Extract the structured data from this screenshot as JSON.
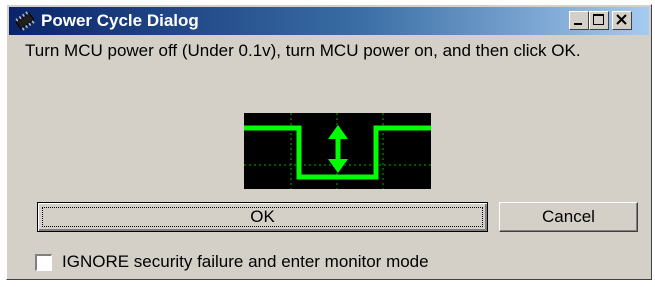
{
  "window": {
    "title": "Power Cycle Dialog",
    "title_icon": "chip-icon",
    "controls": {
      "minimize_icon": "minimize-icon",
      "maximize_icon": "maximize-icon",
      "close_icon": "close-icon"
    }
  },
  "message": {
    "text": "Turn MCU power off (Under 0.1v), turn MCU power on, and then click OK."
  },
  "graphic": {
    "icon": "power-cycle-waveform-icon",
    "colors": {
      "background": "#000000",
      "waveform": "#00ff00",
      "grid": "#00aa00"
    }
  },
  "buttons": {
    "ok_label": "OK",
    "cancel_label": "Cancel"
  },
  "options": {
    "ignore_security_label": "IGNORE security failure and enter monitor mode",
    "ignore_security_checked": false
  },
  "colors": {
    "face": "#d4d0c8",
    "title_start": "#0a246a",
    "title_end": "#a6caf0"
  }
}
